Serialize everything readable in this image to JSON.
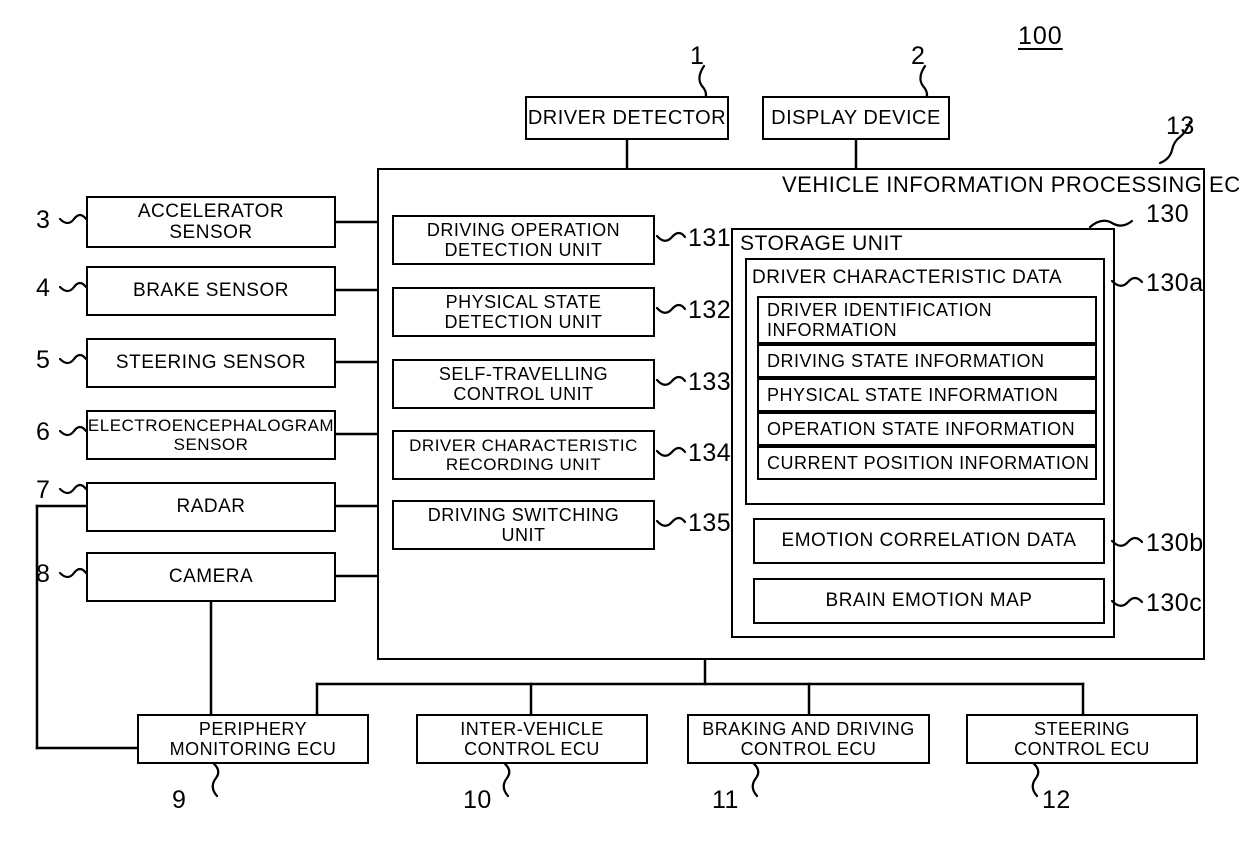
{
  "figure": {
    "system_number": "100",
    "system_number_ref": "100"
  },
  "top_boxes": [
    {
      "label": "DRIVER DETECTOR",
      "ref": "1"
    },
    {
      "label": "DISPLAY DEVICE",
      "ref": "2"
    }
  ],
  "sensors": [
    {
      "label": "ACCELERATOR\nSENSOR",
      "ref": "3"
    },
    {
      "label": "BRAKE SENSOR",
      "ref": "4"
    },
    {
      "label": "STEERING SENSOR",
      "ref": "5"
    },
    {
      "label": "ELECTROENCEPHALOGRAM\nSENSOR",
      "ref": "6"
    },
    {
      "label": "RADAR",
      "ref": "7"
    },
    {
      "label": "CAMERA",
      "ref": "8"
    }
  ],
  "ecu": {
    "title": "VEHICLE INFORMATION PROCESSING ECU",
    "ref": "13",
    "units": [
      {
        "label": "DRIVING OPERATION\nDETECTION UNIT",
        "ref": "131"
      },
      {
        "label": "PHYSICAL STATE\nDETECTION UNIT",
        "ref": "132"
      },
      {
        "label": "SELF-TRAVELLING\nCONTROL UNIT",
        "ref": "133"
      },
      {
        "label": "DRIVER CHARACTERISTIC\nRECORDING UNIT",
        "ref": "134"
      },
      {
        "label": "DRIVING SWITCHING\nUNIT",
        "ref": "135"
      }
    ],
    "storage": {
      "title": "STORAGE UNIT",
      "ref": "130",
      "driver_characteristic_data": {
        "label": "DRIVER CHARACTERISTIC DATA",
        "ref": "130a",
        "items": [
          "DRIVER IDENTIFICATION\nINFORMATION",
          "DRIVING STATE INFORMATION",
          "PHYSICAL STATE INFORMATION",
          "OPERATION STATE INFORMATION",
          "CURRENT POSITION INFORMATION"
        ]
      },
      "emotion_correlation_data": {
        "label": "EMOTION CORRELATION DATA",
        "ref": "130b"
      },
      "brain_emotion_map": {
        "label": "BRAIN EMOTION MAP",
        "ref": "130c"
      }
    }
  },
  "bottom_ecus": [
    {
      "label": "PERIPHERY\nMONITORING ECU",
      "ref": "9"
    },
    {
      "label": "INTER-VEHICLE\nCONTROL ECU",
      "ref": "10"
    },
    {
      "label": "BRAKING AND DRIVING\nCONTROL ECU",
      "ref": "11"
    },
    {
      "label": "STEERING\nCONTROL ECU",
      "ref": "12"
    }
  ]
}
